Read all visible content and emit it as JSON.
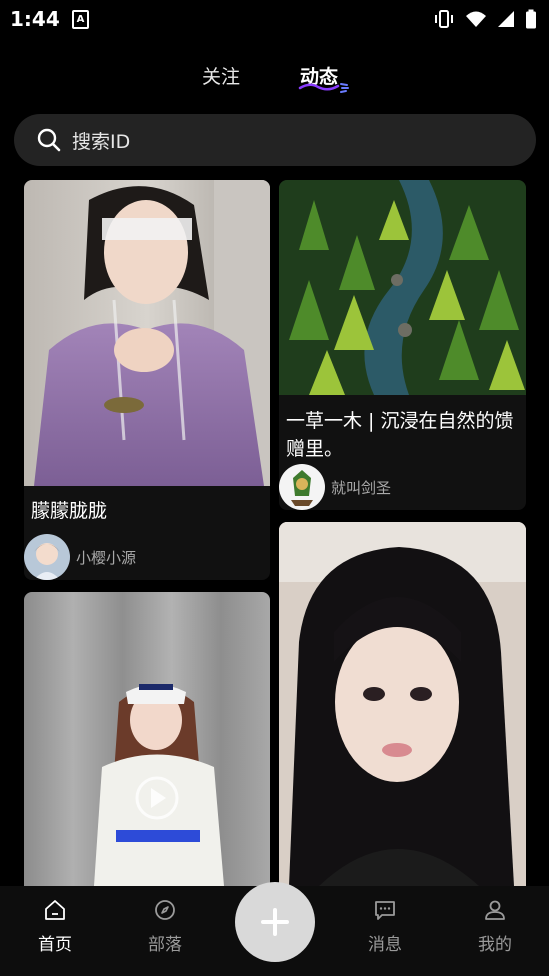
{
  "status_bar": {
    "time": "1:44",
    "a_badge": "A"
  },
  "tabs": {
    "follow": "关注",
    "dynamic": "动态"
  },
  "search": {
    "placeholder": "搜索ID"
  },
  "feed": {
    "left": [
      {
        "title": "朦朦胧胧",
        "author": "小樱小源"
      },
      {
        "title": "",
        "author": ""
      }
    ],
    "right": [
      {
        "title_line1": "一草一木 | 沉浸在自然的馈",
        "title_line2": "赠里。",
        "author": "就叫剑圣"
      },
      {
        "title": "",
        "author": ""
      }
    ]
  },
  "bottom_nav": {
    "home": "首页",
    "tribe": "部落",
    "messages": "消息",
    "mine": "我的"
  },
  "colors": {
    "background": "#000000",
    "card": "#111111",
    "search_bg": "#232323",
    "accent_purple": "#8a3cff"
  }
}
